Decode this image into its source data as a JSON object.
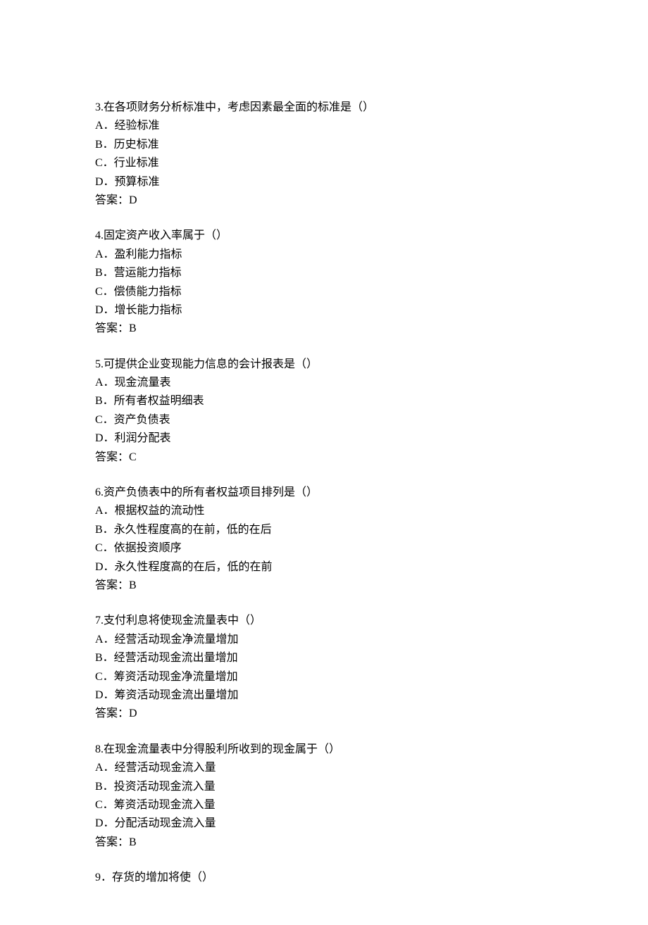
{
  "questions": [
    {
      "number": "3",
      "text": "在各项财务分析标准中，考虑因素最全面的标准是（）",
      "options": [
        {
          "letter": "A",
          "text": "经验标准"
        },
        {
          "letter": "B",
          "text": "历史标准"
        },
        {
          "letter": "C",
          "text": "行业标准"
        },
        {
          "letter": "D",
          "text": "预算标准"
        }
      ],
      "answer_label": "答案：",
      "answer_value": "D"
    },
    {
      "number": "4",
      "text": "固定资产收入率属于（）",
      "options": [
        {
          "letter": "A",
          "text": "盈利能力指标"
        },
        {
          "letter": "B",
          "text": "营运能力指标"
        },
        {
          "letter": "C",
          "text": "偿债能力指标"
        },
        {
          "letter": "D",
          "text": "增长能力指标"
        }
      ],
      "answer_label": "答案：",
      "answer_value": "B"
    },
    {
      "number": "5",
      "text": "可提供企业变现能力信息的会计报表是（）",
      "options": [
        {
          "letter": "A",
          "text": "现金流量表"
        },
        {
          "letter": "B",
          "text": "所有者权益明细表"
        },
        {
          "letter": "C",
          "text": "资产负债表"
        },
        {
          "letter": "D",
          "text": "利润分配表"
        }
      ],
      "answer_label": "答案：",
      "answer_value": "C"
    },
    {
      "number": "6",
      "text": "资产负债表中的所有者权益项目排列是（）",
      "options": [
        {
          "letter": "A",
          "text": "根据权益的流动性"
        },
        {
          "letter": "B",
          "text": "永久性程度高的在前，低的在后"
        },
        {
          "letter": "C",
          "text": "依据投资顺序"
        },
        {
          "letter": "D",
          "text": "永久性程度高的在后，低的在前"
        }
      ],
      "answer_label": "答案：",
      "answer_value": "B"
    },
    {
      "number": "7",
      "text": "支付利息将使现金流量表中（）",
      "options": [
        {
          "letter": "A",
          "text": "经营活动现金净流量增加"
        },
        {
          "letter": "B",
          "text": "经营活动现金流出量增加"
        },
        {
          "letter": "C",
          "text": "筹资活动现金净流量增加"
        },
        {
          "letter": "D",
          "text": "筹资活动现金流出量增加"
        }
      ],
      "answer_label": "答案：",
      "answer_value": "D"
    },
    {
      "number": "8",
      "text": "在现金流量表中分得股利所收到的现金属于（）",
      "options": [
        {
          "letter": "A",
          "text": "经营活动现金流入量"
        },
        {
          "letter": "B",
          "text": "投资活动现金流入量"
        },
        {
          "letter": "C",
          "text": "筹资活动现金流入量"
        },
        {
          "letter": "D",
          "text": "分配活动现金流入量"
        }
      ],
      "answer_label": "答案：",
      "answer_value": "B"
    },
    {
      "number": "9",
      "text": "存货的增加将使（）",
      "options": [],
      "answer_label": "",
      "answer_value": ""
    }
  ]
}
